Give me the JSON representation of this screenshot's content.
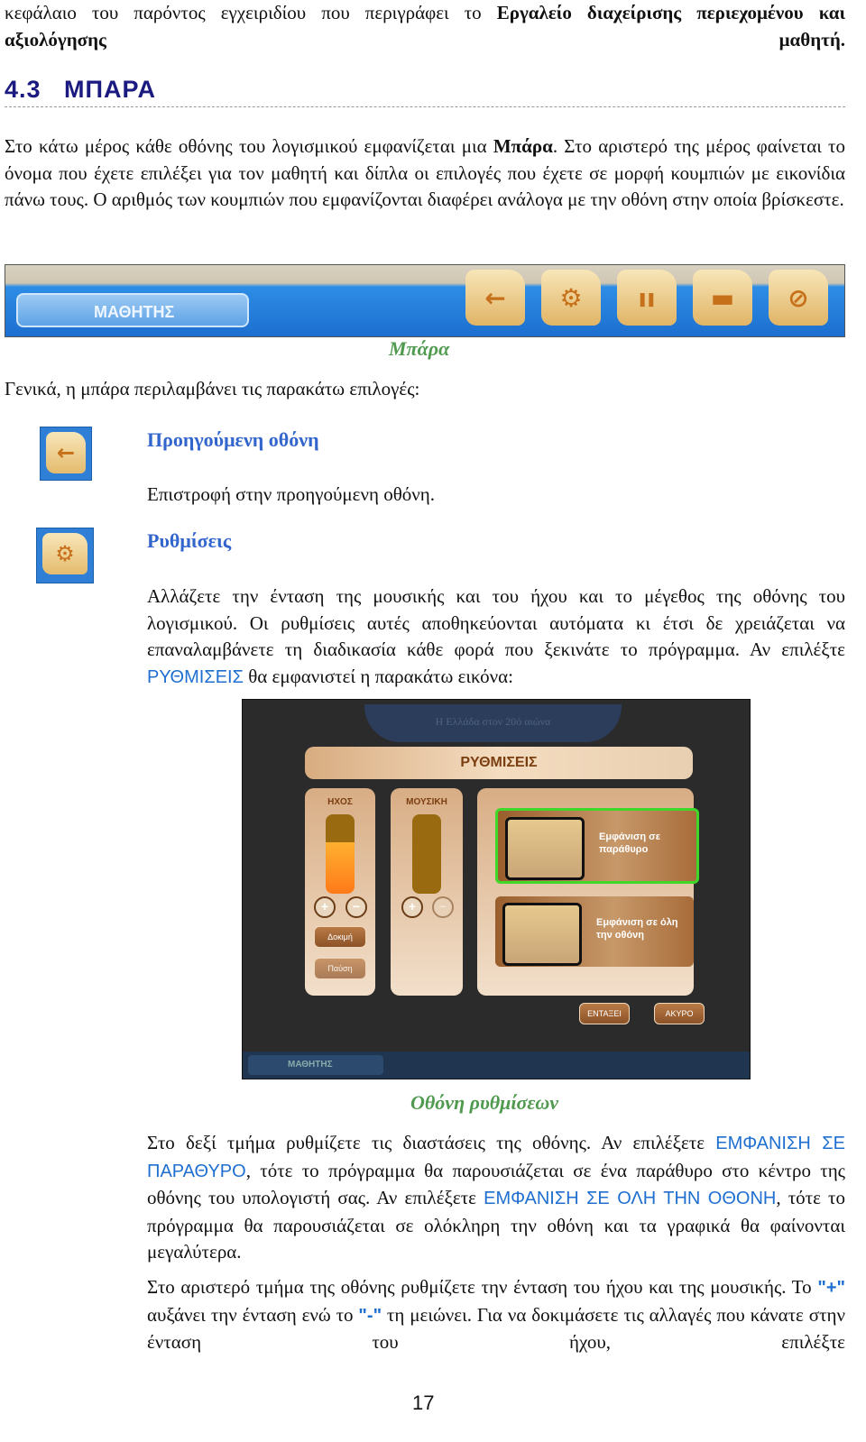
{
  "intro": {
    "text_before": "κεφάλαιο του παρόντος εγχειριδίου που περιγράφει το ",
    "bold": "Εργαλείο διαχείρισης περιεχομένου και αξιολόγησης μαθητή."
  },
  "section": {
    "title": "4.3   ΜΠΑΡΑ"
  },
  "para1": {
    "a": "Στο κάτω μέρος κάθε οθόνης του λογισμικού εμφανίζεται μια ",
    "bold": "Μπάρα",
    "b": ". Στο αριστερό της μέρος φαίνεται το όνομα που έχετε επιλέξει για τον μαθητή και δίπλα οι επιλογές που έχετε σε μορφή κουμπιών με εικονίδια πάνω τους. Ο αριθμός των κουμπιών που εμφανίζονται διαφέρει ανάλογα με την οθόνη στην οποία βρίσκεστε."
  },
  "bar": {
    "student_label": "ΜΑΘΗΤΗΣ",
    "buttons": [
      "arrow-left-icon",
      "gear-icon",
      "players-icon",
      "printer-icon",
      "exit-icon"
    ],
    "caption": "Μπάρα"
  },
  "options_intro": "Γενικά, η μπάρα περιλαμβάνει τις παρακάτω επιλογές:",
  "items": [
    {
      "icon": "arrow-left-icon",
      "title": "Προηγούμενη οθόνη",
      "desc": "Επιστροφή στην προηγούμενη οθόνη."
    },
    {
      "icon": "gear-icon",
      "title": "Ρυθμίσεις",
      "desc_a": "Αλλάζετε την ένταση της μουσικής και του ήχου και το μέγεθος της οθόνης του λογισμικού. Οι ρυθμίσεις αυτές αποθηκεύονται αυτόματα κι έτσι δε χρειάζεται να επαναλαμβάνετε τη διαδικασία κάθε φορά που ξεκινάτε το πρόγραμμα. Αν επιλέξτε ",
      "desc_caps": "ΡΥΘΜΙΣΕΙΣ",
      "desc_b": " θα εμφανιστεί η παρακάτω εικόνα:"
    }
  ],
  "settings_screen": {
    "ribbon": "Η Ελλάδα στον 20ό αιώνα",
    "title": "ΡΥΘΜΙΣΕΙΣ",
    "sound_label": "ΗΧΟΣ",
    "music_label": "ΜΟΥΣΙΚΗ",
    "plus": "+",
    "minus": "−",
    "test_button": "Δοκιμή",
    "pause_button": "Παύση",
    "window_option": "Εμφάνιση σε παράθυρο",
    "fullscreen_option": "Εμφάνιση σε όλη την οθόνη",
    "ok_button": "ΕΝΤΑΞΕΙ",
    "cancel_button": "ΑΚΥΡΟ",
    "student_label": "ΜΑΘΗΤΗΣ",
    "sound_level": 0.6,
    "music_level": 0,
    "selected_option": "window",
    "caption": "Οθόνη ρυθμίσεων"
  },
  "para2": {
    "a": "Στο δεξί τμήμα ρυθμίζετε τις διαστάσεις της οθόνης. Αν επιλέξετε ",
    "caps1": "ΕΜΦΑΝΙΣΗ ΣΕ ΠΑΡΑΘΥΡΟ",
    "b": ", τότε το πρόγραμμα θα παρουσιάζεται σε ένα παράθυρο στο κέντρο της οθόνης του υπολογιστή σας. Αν επιλέξετε ",
    "caps2": "ΕΜΦΑΝΙΣΗ ΣΕ ΟΛΗ ΤΗΝ ΟΘΟΝΗ",
    "c": ", τότε το πρόγραμμα θα παρουσιάζεται σε ολόκληρη την οθόνη και τα γραφικά θα φαίνονται μεγαλύτερα."
  },
  "para3": {
    "a": "Στο αριστερό τμήμα της οθόνης ρυθμίζετε την ένταση του ήχου και της μουσικής. Το ",
    "plus": "\"+\"",
    "b": " αυξάνει την ένταση ενώ το ",
    "minus": "\"-\"",
    "c": " τη μειώνει. Για να δοκιμάσετε τις αλλαγές που κάνατε στην ένταση του ήχου, επιλέξτε"
  },
  "page_number": "17",
  "colors": {
    "heading": "#1a1a80",
    "subheading": "#3366cc",
    "caption": "#4f9a4f",
    "caps_text": "#1f6fd0"
  }
}
